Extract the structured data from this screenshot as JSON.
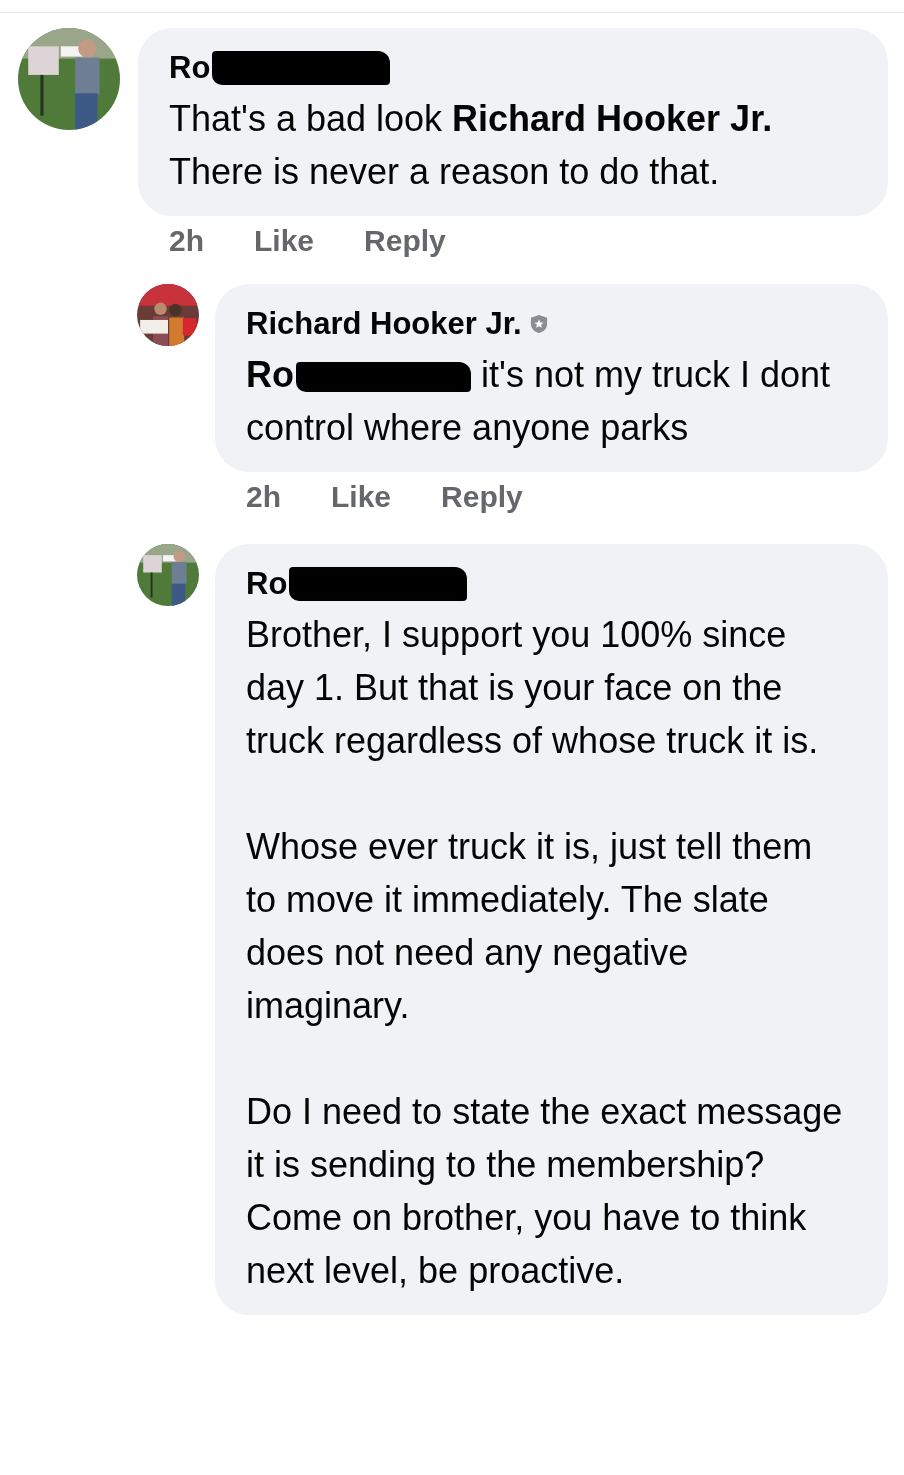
{
  "comments": [
    {
      "author": "Ro",
      "author_redacted": true,
      "avatar": {
        "kind": "picture"
      },
      "text": "That's a bad look **Richard Hooker Jr.** There is never a reason to do that.",
      "time": "2h",
      "actions": [
        "Like",
        "Reply"
      ],
      "replies": [
        {
          "author": "Richard Hooker Jr.",
          "verified": true,
          "avatar": {
            "kind": "picture"
          },
          "mention": "Ro",
          "mention_redacted": true,
          "text": "it's not my truck I dont control where anyone parks",
          "time": "2h",
          "actions": [
            "Like",
            "Reply"
          ]
        },
        {
          "author": "Ro",
          "author_redacted": true,
          "avatar": {
            "kind": "picture"
          },
          "paragraphs": [
            "Brother, I support you 100% since day 1. But that is your face on the truck regardless of whose truck it is.",
            "Whose ever truck it is, just tell them to move it immediately. The slate does not need any negative imaginary.",
            "Do I need to state the exact message it is sending to the membership? Come on brother, you have to think next level, be proactive."
          ]
        }
      ]
    }
  ]
}
